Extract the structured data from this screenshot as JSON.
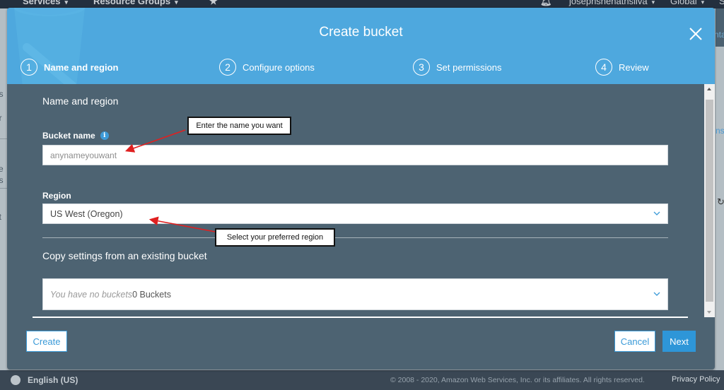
{
  "console": {
    "nav": {
      "services": "Services",
      "resource_groups": "Resource Groups",
      "user": "josephshenathsilva",
      "region": "Global",
      "support_initial": "S"
    },
    "left_fragments": [
      "ns",
      "er",
      "ce",
      "gs",
      "ht"
    ],
    "right_fragments": [
      "nta",
      "ns"
    ],
    "footer": {
      "language": "English (US)",
      "copyright": "© 2008 - 2020, Amazon Web Services, Inc. or its affiliates. All rights reserved.",
      "privacy": "Privacy Policy"
    }
  },
  "modal": {
    "title": "Create bucket",
    "steps": [
      {
        "number": "1",
        "label": "Name and region",
        "active": true
      },
      {
        "number": "2",
        "label": "Configure options",
        "active": false
      },
      {
        "number": "3",
        "label": "Set permissions",
        "active": false
      },
      {
        "number": "4",
        "label": "Review",
        "active": false
      }
    ],
    "section_title": "Name and region",
    "bucket_name": {
      "label": "Bucket name",
      "value": "",
      "placeholder": "anynameyouwant"
    },
    "region": {
      "label": "Region",
      "selected": "US West (Oregon)"
    },
    "copy_settings": {
      "label": "Copy settings from an existing bucket",
      "placeholder": "You have no buckets",
      "count": "0 Buckets"
    },
    "buttons": {
      "create": "Create",
      "cancel": "Cancel",
      "next": "Next"
    }
  },
  "annotations": {
    "bucket_name_callout": "Enter the name you want",
    "region_callout": "Select your preferred region",
    "arrow_color": "#e02020"
  },
  "colors": {
    "header_blue": "#4ea8de",
    "body_slate": "#4d6372",
    "primary_button": "#2e96d8"
  }
}
